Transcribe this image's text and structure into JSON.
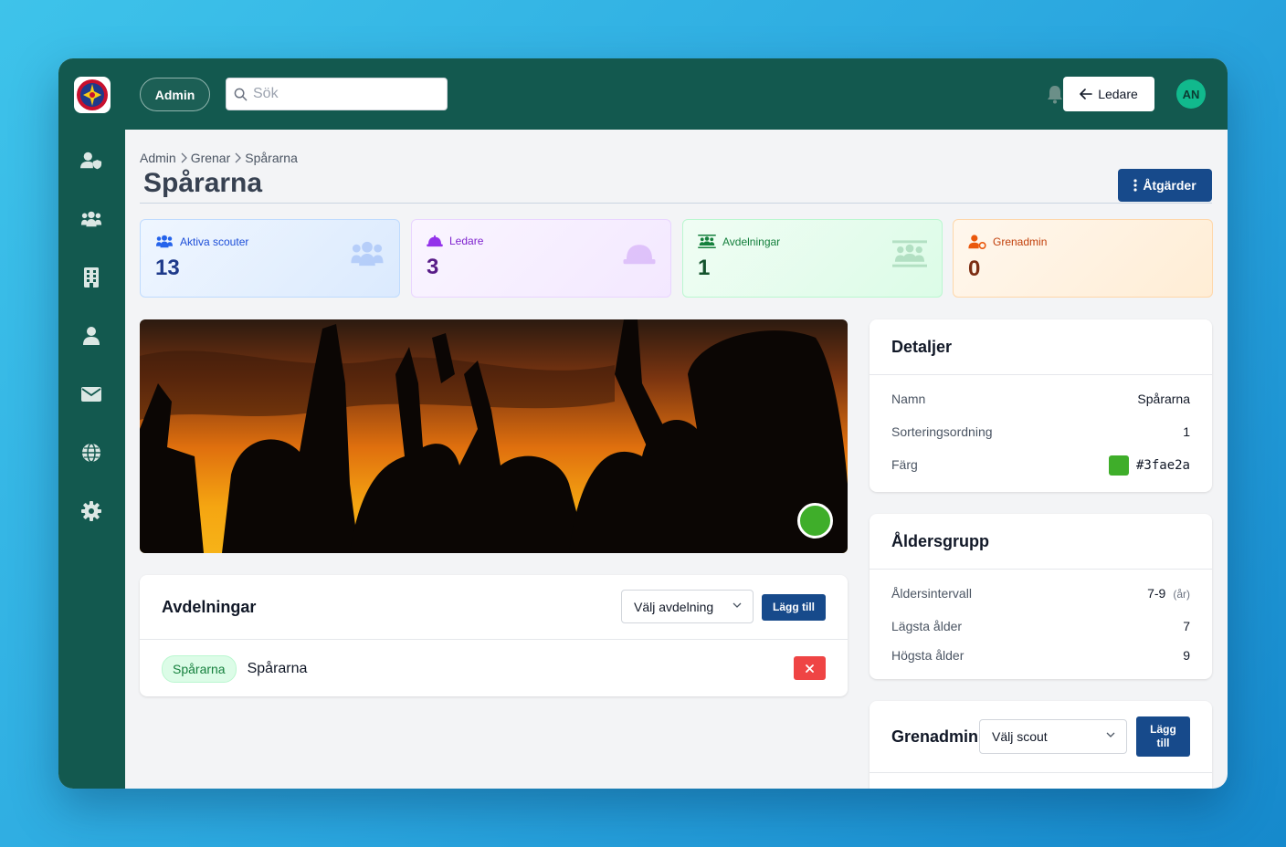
{
  "header": {
    "admin_label": "Admin",
    "search_placeholder": "Sök",
    "ledare_label": "Ledare",
    "avatar_initials": "AN"
  },
  "sidebar": {
    "items": [
      {
        "icon": "user-shield-icon"
      },
      {
        "icon": "users-icon"
      },
      {
        "icon": "building-icon"
      },
      {
        "icon": "user-icon"
      },
      {
        "icon": "envelope-icon"
      },
      {
        "icon": "globe-icon"
      },
      {
        "icon": "gear-icon"
      }
    ]
  },
  "breadcrumb": [
    "Admin",
    "Grenar",
    "Spårarna"
  ],
  "page": {
    "title": "Spårarna",
    "actions_label": "Åtgärder"
  },
  "stats": [
    {
      "label": "Aktiva scouter",
      "value": "13",
      "color": "#2563eb",
      "icon": "users-icon"
    },
    {
      "label": "Ledare",
      "value": "3",
      "color": "#9333ea",
      "icon": "hard-hat-icon"
    },
    {
      "label": "Avdelningar",
      "value": "1",
      "color": "#15803d",
      "icon": "group-icon"
    },
    {
      "label": "Grenadmin",
      "value": "0",
      "color": "#c2410c",
      "icon": "user-gear-icon"
    }
  ],
  "branch_color": "#3fae2a",
  "avdelningar": {
    "title": "Avdelningar",
    "select_label": "Välj avdelning",
    "add_label": "Lägg till",
    "items": [
      {
        "tag": "Spårarna",
        "name": "Spårarna"
      }
    ]
  },
  "details": {
    "title": "Detaljer",
    "rows": [
      {
        "label": "Namn",
        "value": "Spårarna"
      },
      {
        "label": "Sorteringsordning",
        "value": "1"
      },
      {
        "label": "Färg",
        "value": "#3fae2a"
      }
    ]
  },
  "age_group": {
    "title": "Åldersgrupp",
    "interval_label": "Åldersintervall",
    "interval_value": "7-9",
    "interval_unit": "(år)",
    "min_label": "Lägsta ålder",
    "min_value": "7",
    "max_label": "Högsta ålder",
    "max_value": "9"
  },
  "grenadmin": {
    "title": "Grenadmin",
    "select_label": "Välj scout",
    "add_label": "Lägg till"
  }
}
